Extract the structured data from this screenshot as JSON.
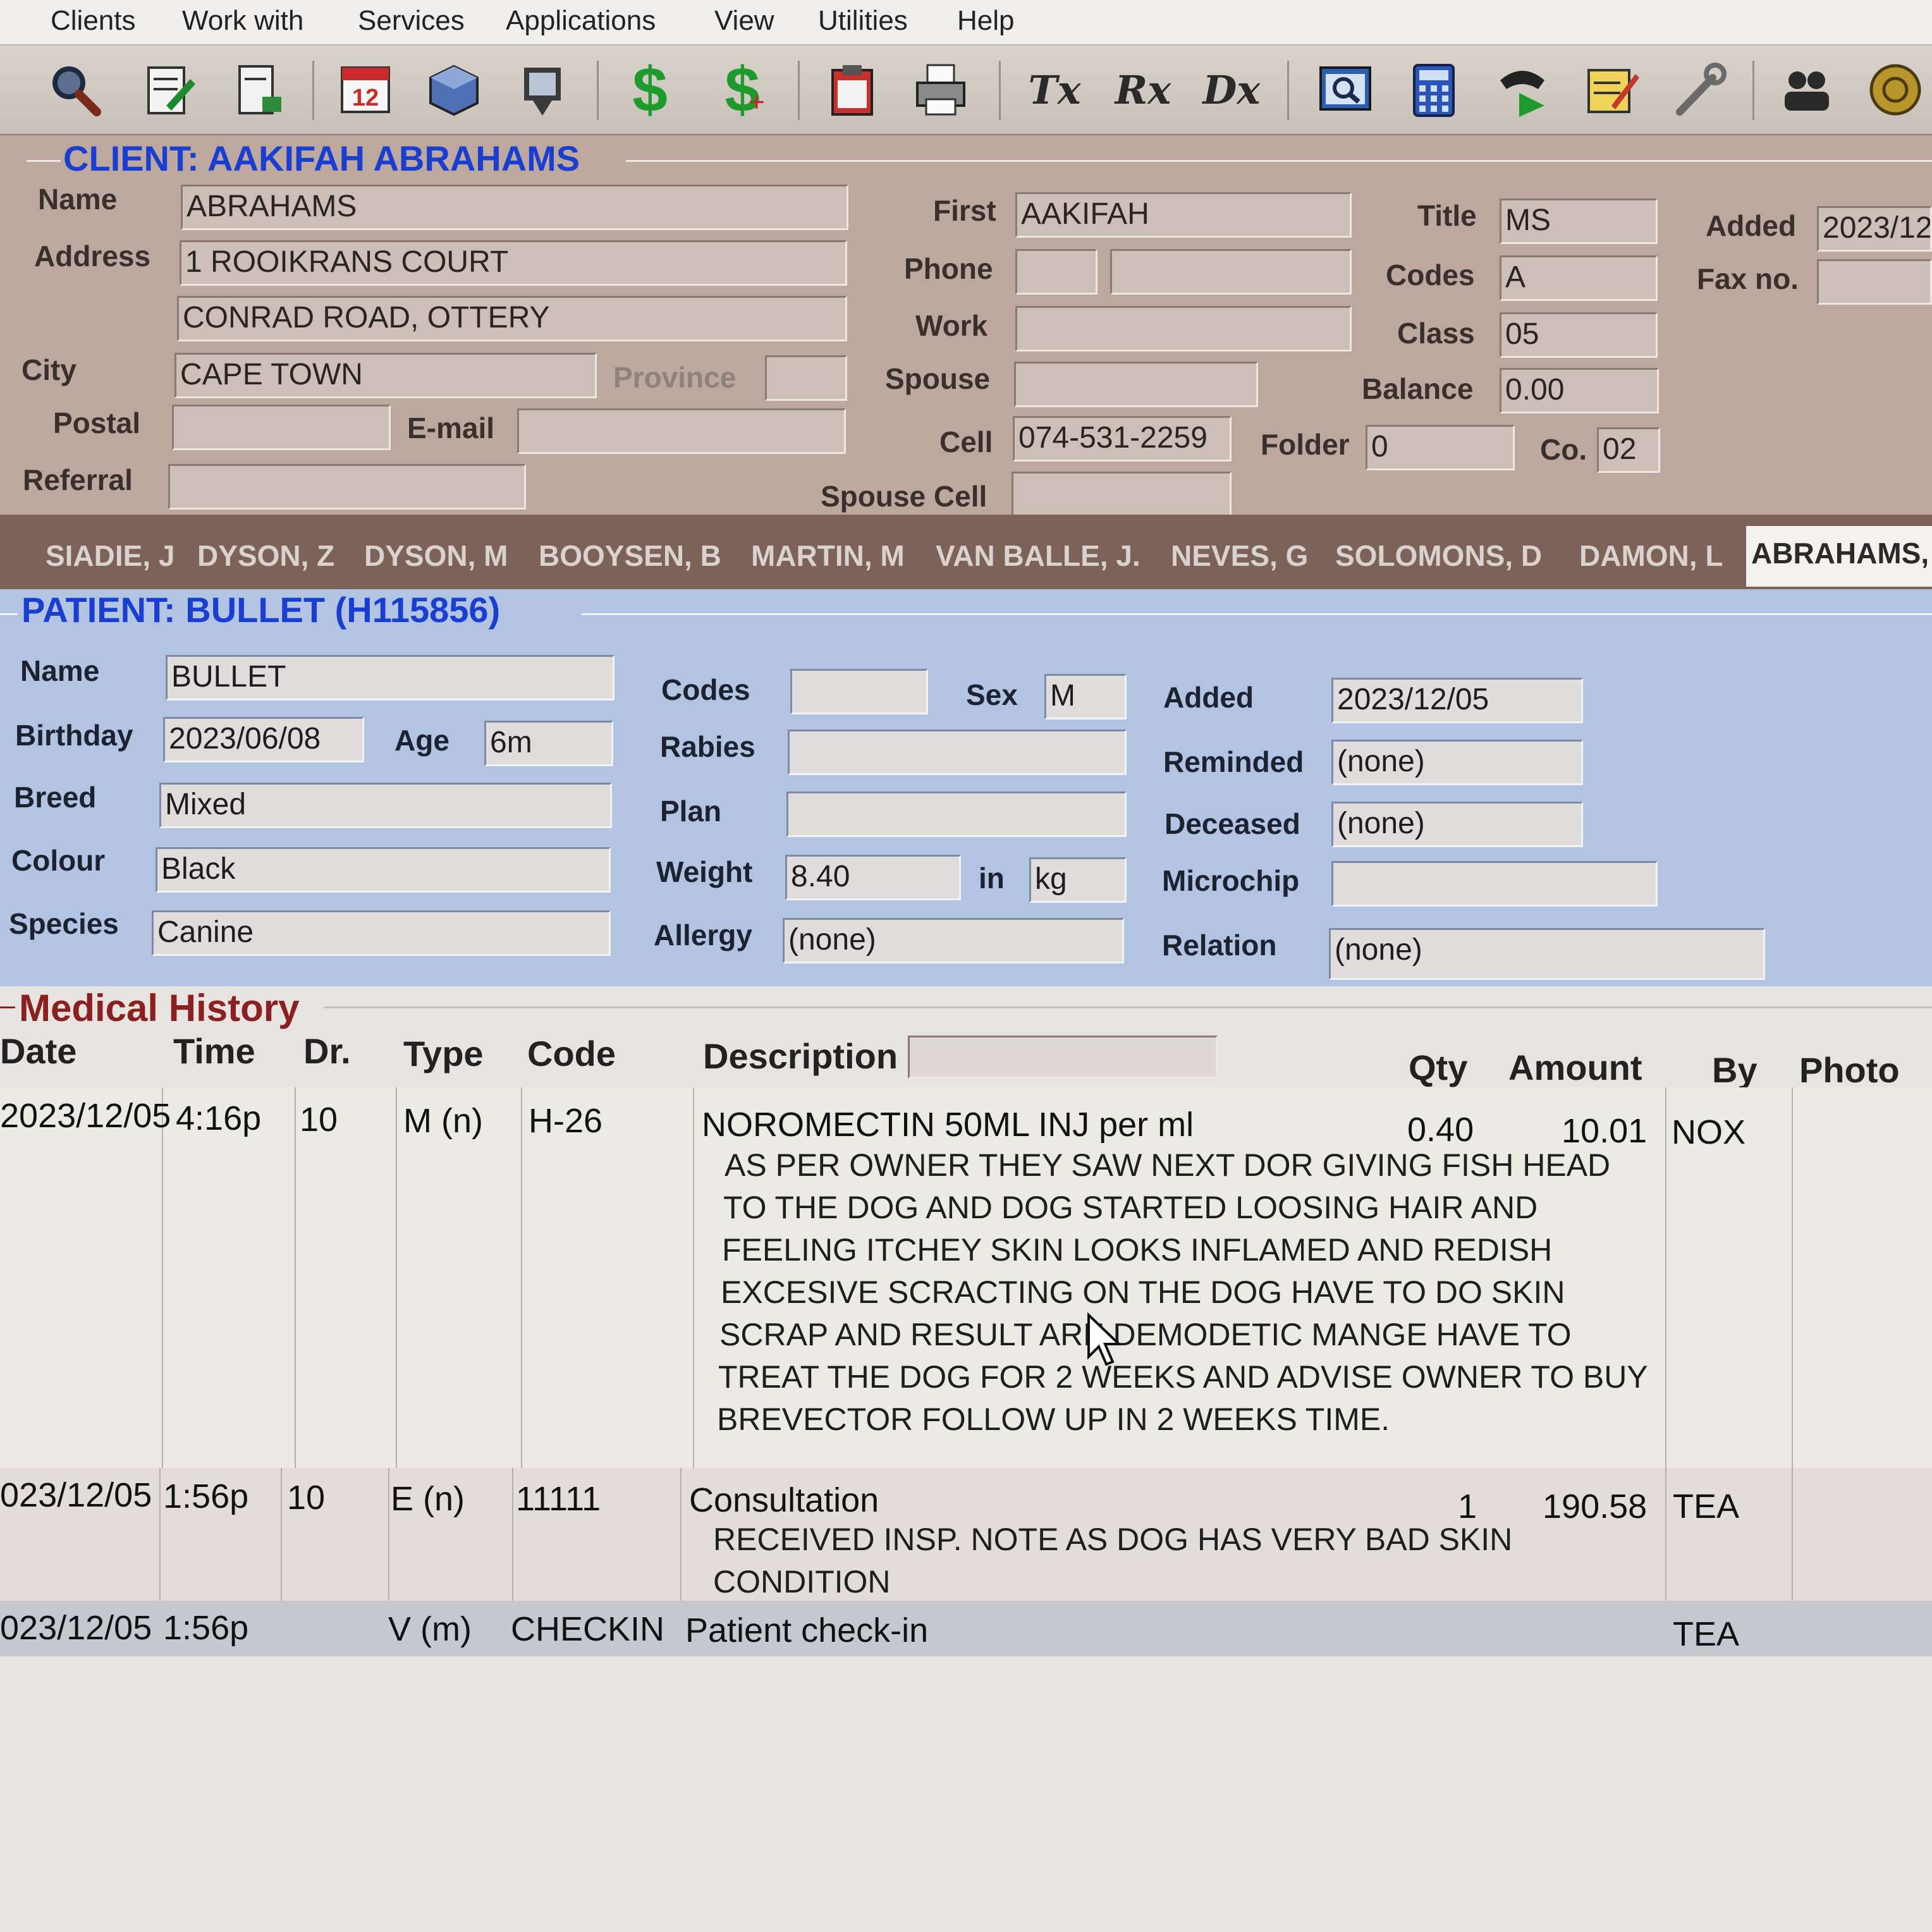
{
  "menu": [
    "Clients",
    "Work with",
    "Services",
    "Applications",
    "View",
    "Utilities",
    "Help"
  ],
  "toolbar": {
    "icons": [
      "search-icon",
      "edit-record-icon",
      "new-document-icon",
      "calendar-icon",
      "package-icon",
      "tag-icon",
      "dollar-icon",
      "dollar-add-icon",
      "clipboard-icon",
      "printer-icon",
      "tx-icon",
      "rx-icon",
      "dx-icon",
      "view-icon",
      "calculator-icon",
      "phone-icon",
      "note-icon",
      "wrench-icon",
      "people-icon",
      "coin-icon"
    ],
    "calendar_day": "12",
    "tx": "Tx",
    "rx": "Rx",
    "dx": "Dx"
  },
  "client": {
    "group_title": "CLIENT: AAKIFAH ABRAHAMS",
    "labels": {
      "name": "Name",
      "address": "Address",
      "city": "City",
      "province": "Province",
      "postal": "Postal",
      "email": "E-mail",
      "referral": "Referral",
      "first": "First",
      "phone": "Phone",
      "work": "Work",
      "spouse": "Spouse",
      "cell": "Cell",
      "spouse_cell": "Spouse Cell",
      "title": "Title",
      "codes": "Codes",
      "class": "Class",
      "balance": "Balance",
      "folder": "Folder",
      "co": "Co.",
      "added": "Added",
      "fax": "Fax no."
    },
    "values": {
      "name": "ABRAHAMS",
      "address1": "1 ROOIKRANS COURT",
      "address2": "CONRAD ROAD, OTTERY",
      "city": "CAPE TOWN",
      "province": "",
      "postal": "",
      "email": "",
      "referral": "",
      "first": "AAKIFAH",
      "phone_area": "",
      "phone": "",
      "work": "",
      "spouse": "",
      "cell": "074-531-2259",
      "spouse_cell": "",
      "title": "MS",
      "codes": "A",
      "class": "05",
      "balance": "0.00",
      "folder": "0",
      "co": "02",
      "added": "2023/12",
      "fax": ""
    }
  },
  "tabs": [
    "SIADIE, J",
    "DYSON, Z",
    "DYSON, M",
    "BOOYSEN, B",
    "MARTIN, M",
    "VAN BALLE, J.",
    "NEVES, G",
    "SOLOMONS, D",
    "DAMON, L",
    "ABRAHAMS,"
  ],
  "active_tab": 9,
  "patient": {
    "group_title": "PATIENT: BULLET (H115856)",
    "labels": {
      "name": "Name",
      "birthday": "Birthday",
      "age": "Age",
      "breed": "Breed",
      "colour": "Colour",
      "species": "Species",
      "codes": "Codes",
      "sex": "Sex",
      "rabies": "Rabies",
      "plan": "Plan",
      "weight": "Weight",
      "in": "in",
      "allergy": "Allergy",
      "added": "Added",
      "reminded": "Reminded",
      "deceased": "Deceased",
      "microchip": "Microchip",
      "relation": "Relation"
    },
    "values": {
      "name": "BULLET",
      "birthday": "2023/06/08",
      "age": "6m",
      "breed": "Mixed",
      "colour": "Black",
      "species": "Canine",
      "codes": "",
      "sex": "M",
      "rabies": "",
      "plan": "",
      "weight": "8.40",
      "unit": "kg",
      "allergy": "(none)",
      "added": "2023/12/05",
      "reminded": "(none)",
      "deceased": "(none)",
      "microchip": "",
      "relation": "(none)"
    }
  },
  "history": {
    "title": "Medical History",
    "columns": {
      "date": "Date",
      "time": "Time",
      "dr": "Dr.",
      "type": "Type",
      "code": "Code",
      "description": "Description",
      "qty": "Qty",
      "amount": "Amount",
      "by": "By",
      "photo": "Photo"
    },
    "description_filter": "",
    "rows": [
      {
        "date": "2023/12/05",
        "time": "4:16p",
        "dr": "10",
        "type": "M (n)",
        "code": "H-26",
        "description": "NOROMECTIN 50ML INJ per ml",
        "qty": "0.40",
        "amount": "10.01",
        "by": "NOX",
        "notes": [
          "AS PER OWNER THEY SAW NEXT DOR GIVING FISH HEAD",
          "TO THE DOG AND DOG STARTED LOOSING HAIR AND",
          "FEELING ITCHEY SKIN LOOKS INFLAMED AND REDISH",
          "EXCESIVE SCRACTING ON THE DOG HAVE TO DO SKIN",
          "SCRAP AND RESULT ARE DEMODETIC MANGE HAVE TO",
          "TREAT THE DOG FOR 2 WEEKS AND ADVISE OWNER TO BUY",
          "BREVECTOR FOLLOW UP IN 2 WEEKS TIME."
        ]
      },
      {
        "date": "023/12/05",
        "time": "1:56p",
        "dr": "10",
        "type": "E (n)",
        "code": "11111",
        "description": "Consultation",
        "qty": "1",
        "amount": "190.58",
        "by": "TEA",
        "notes": [
          "RECEIVED INSP. NOTE AS DOG HAS VERY BAD SKIN",
          "CONDITION"
        ]
      },
      {
        "date": "023/12/05",
        "time": "1:56p",
        "dr": "",
        "type": "V (m)",
        "code": "CHECKIN",
        "description": "Patient check-in",
        "qty": "",
        "amount": "",
        "by": "TEA",
        "notes": []
      }
    ]
  }
}
